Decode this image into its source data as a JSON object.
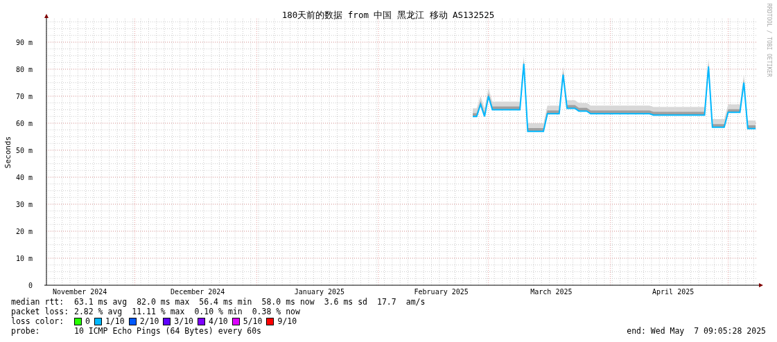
{
  "chart": {
    "chart_data": {
      "type": "line",
      "title": "180天前的数据 from 中国 黑龙江 移动 AS132525",
      "ylabel": "Seconds",
      "categories": [
        null,
        null,
        null,
        null,
        null,
        null,
        null,
        null,
        "November 2024",
        null,
        null,
        null,
        null,
        null,
        null,
        null,
        null,
        null,
        null,
        null,
        null,
        null,
        null,
        null,
        null,
        null,
        null,
        null,
        null,
        null,
        null,
        null,
        null,
        null,
        null,
        null,
        null,
        null,
        "December 2024",
        null,
        null,
        null,
        null,
        null,
        null,
        null,
        null,
        null,
        null,
        null,
        null,
        null,
        null,
        null,
        null,
        null,
        null,
        null,
        null,
        null,
        null,
        null,
        null,
        null,
        null,
        null,
        null,
        null,
        null,
        "January 2025",
        null,
        null,
        null,
        null,
        null,
        null,
        null,
        null,
        null,
        null,
        null,
        null,
        null,
        null,
        null,
        null,
        null,
        null,
        null,
        null,
        null,
        null,
        null,
        null,
        null,
        null,
        null,
        null,
        null,
        null,
        "February 2025",
        null,
        null,
        null,
        null,
        null,
        null,
        null,
        null,
        null,
        null,
        null,
        null,
        null,
        null,
        null,
        null,
        null,
        null,
        null,
        null,
        null,
        null,
        null,
        null,
        null,
        null,
        null,
        "March 2025",
        null,
        null,
        null,
        null,
        null,
        null,
        null,
        null,
        null,
        null,
        null,
        null,
        null,
        null,
        null,
        null,
        null,
        null,
        null,
        null,
        null,
        null,
        null,
        null,
        null,
        null,
        null,
        null,
        null,
        null,
        "April 2025",
        null,
        null,
        null,
        null,
        null,
        null,
        null,
        null,
        null,
        null,
        null,
        null,
        null,
        null,
        null,
        null,
        null,
        null,
        null,
        null,
        null
      ],
      "series": [
        {
          "color": "#00b8ff",
          "values": [
            null,
            null,
            null,
            null,
            null,
            null,
            null,
            null,
            null,
            null,
            null,
            null,
            null,
            null,
            null,
            null,
            null,
            null,
            null,
            null,
            null,
            null,
            null,
            null,
            null,
            null,
            null,
            null,
            null,
            null,
            null,
            null,
            null,
            null,
            null,
            null,
            null,
            null,
            null,
            null,
            null,
            null,
            null,
            null,
            null,
            null,
            null,
            null,
            null,
            null,
            null,
            null,
            null,
            null,
            null,
            null,
            null,
            null,
            null,
            null,
            null,
            null,
            null,
            null,
            null,
            null,
            null,
            null,
            null,
            null,
            null,
            null,
            null,
            null,
            null,
            null,
            null,
            null,
            null,
            null,
            null,
            null,
            null,
            null,
            null,
            null,
            null,
            null,
            null,
            null,
            null,
            null,
            null,
            null,
            null,
            null,
            null,
            null,
            null,
            null,
            null,
            null,
            null,
            null,
            null,
            null,
            null,
            null,
            62.5,
            62.5,
            67,
            62.5,
            70,
            65,
            65,
            65,
            65,
            65,
            65,
            65,
            65,
            82,
            57,
            57,
            57,
            57,
            57,
            63.5,
            63.5,
            63.5,
            63.5,
            78,
            65.5,
            65.5,
            65.5,
            64.5,
            64.5,
            64.5,
            63.5,
            63.5,
            63.5,
            63.5,
            63.5,
            63.5,
            63.5,
            63.5,
            63.5,
            63.5,
            63.5,
            63.5,
            63.5,
            63.5,
            63.5,
            63.5,
            63,
            63,
            63,
            63,
            63,
            63,
            63,
            63,
            63,
            63,
            63,
            63,
            63,
            63,
            81,
            58.5,
            58.5,
            58.5,
            58.5,
            64,
            64,
            64,
            64,
            75,
            58,
            58,
            58
          ]
        }
      ],
      "ylim": [
        0,
        98.7
      ],
      "grid": true,
      "yticks": [
        {
          "value": 0,
          "label": "0"
        },
        {
          "value": 10,
          "label": "10 m"
        },
        {
          "value": 20,
          "label": "20 m"
        },
        {
          "value": 30,
          "label": "30 m"
        },
        {
          "value": 40,
          "label": "40 m"
        },
        {
          "value": 50,
          "label": "50 m"
        },
        {
          "value": 60,
          "label": "60 m"
        },
        {
          "value": 70,
          "label": "70 m"
        },
        {
          "value": 80,
          "label": "80 m"
        },
        {
          "value": 90,
          "label": "90 m"
        }
      ]
    },
    "credit": "RRDTOOL / TOBI OETIKER"
  },
  "legend": {
    "median_rtt": {
      "label": "median rtt:",
      "values": [
        "63.1 ms avg",
        "82.0 ms max",
        "56.4 ms min",
        "58.0 ms now",
        "3.6 ms sd",
        "17.7",
        "am/s"
      ]
    },
    "packet_loss": {
      "label": "packet loss:",
      "values": [
        "2.82 % avg",
        "11.11 % max",
        "0.10 % min",
        "0.38 % now"
      ]
    },
    "loss_color": {
      "label": "loss color:",
      "items": [
        {
          "label": "0",
          "color": "#26ff00"
        },
        {
          "label": "1/10",
          "color": "#00b8ff"
        },
        {
          "label": "2/10",
          "color": "#0059ff"
        },
        {
          "label": "3/10",
          "color": "#5e00ff"
        },
        {
          "label": "4/10",
          "color": "#7e00ff"
        },
        {
          "label": "5/10",
          "color": "#dd00ff"
        },
        {
          "label": "9/10",
          "color": "#ff0000"
        }
      ]
    },
    "probe": {
      "label": "probe:",
      "value": "10 ICMP Echo Pings (64 Bytes) every 60s"
    },
    "end": "end: Wed May  7 09:05:28 2025"
  }
}
